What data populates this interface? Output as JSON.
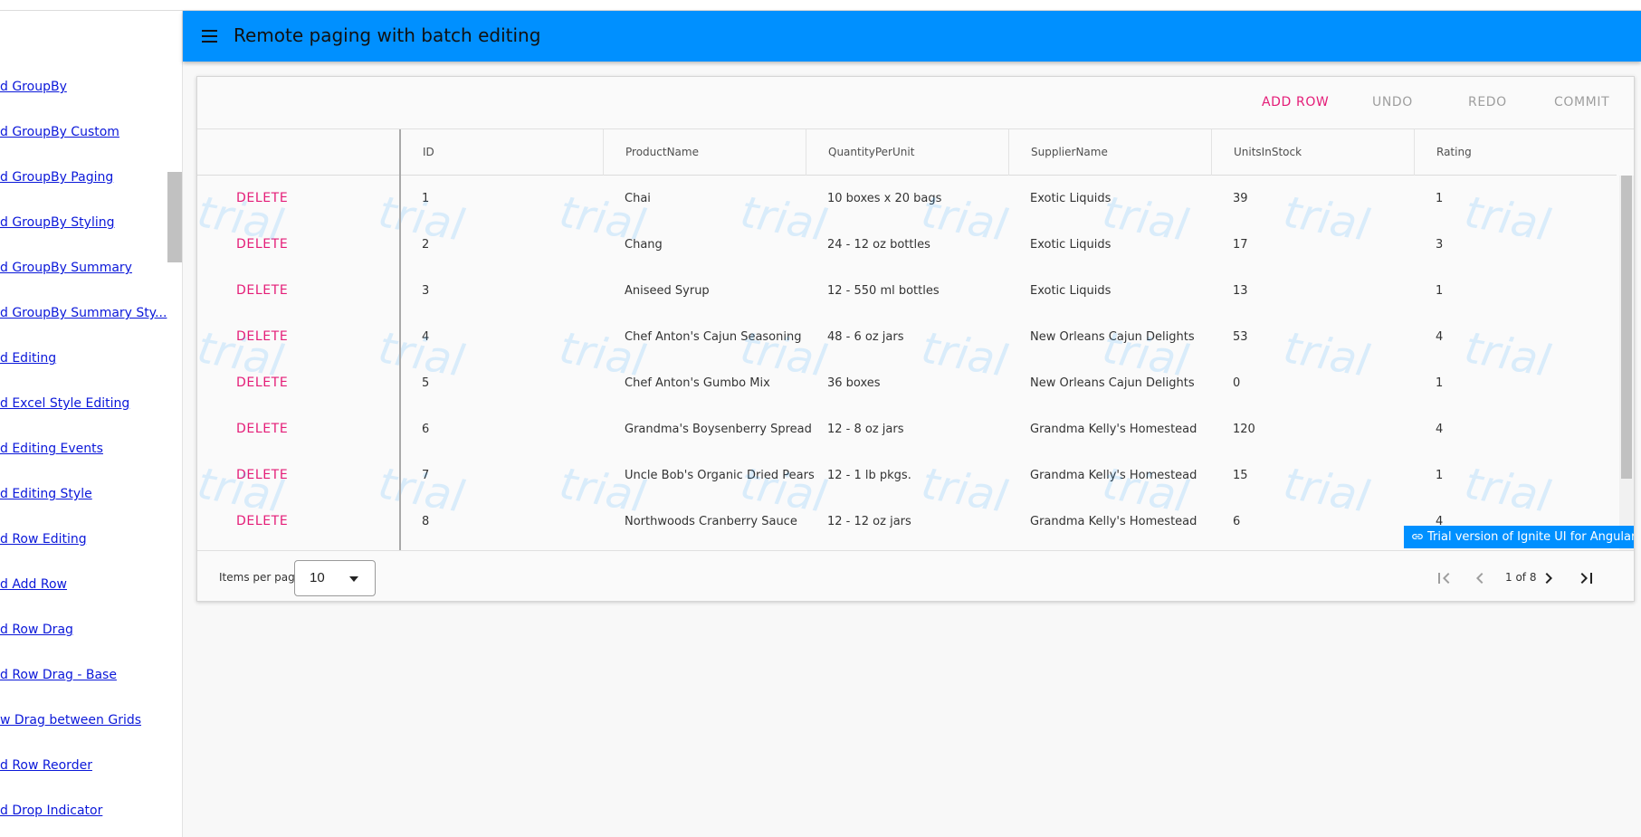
{
  "header": {
    "title": "Remote paging with batch editing"
  },
  "sidebar": {
    "items": [
      "d GroupBy",
      "d GroupBy Custom",
      "d GroupBy Paging",
      "d GroupBy Styling",
      "d GroupBy Summary",
      "d GroupBy Summary Sty...",
      "d Editing",
      "d Excel Style Editing",
      "d Editing Events",
      "d Editing Style",
      "d Row Editing",
      "d Add Row",
      "d Row Drag",
      "d Row Drag - Base",
      "w Drag between Grids",
      "d Row Reorder",
      "d Drop Indicator"
    ]
  },
  "toolbar": {
    "add_row": "ADD ROW",
    "undo": "UNDO",
    "redo": "REDO",
    "commit": "COMMIT"
  },
  "grid": {
    "columns": [
      "ID",
      "ProductName",
      "QuantityPerUnit",
      "SupplierName",
      "UnitsInStock",
      "Rating"
    ],
    "delete_label": "DELETE",
    "rows": [
      [
        "1",
        "Chai",
        "10 boxes x 20 bags",
        "Exotic Liquids",
        "39",
        "1"
      ],
      [
        "2",
        "Chang",
        "24 - 12 oz bottles",
        "Exotic Liquids",
        "17",
        "3"
      ],
      [
        "3",
        "Aniseed Syrup",
        "12 - 550 ml bottles",
        "Exotic Liquids",
        "13",
        "1"
      ],
      [
        "4",
        "Chef Anton's Cajun Seasoning",
        "48 - 6 oz jars",
        "New Orleans Cajun Delights",
        "53",
        "4"
      ],
      [
        "5",
        "Chef Anton's Gumbo Mix",
        "36 boxes",
        "New Orleans Cajun Delights",
        "0",
        "1"
      ],
      [
        "6",
        "Grandma's Boysenberry Spread",
        "12 - 8 oz jars",
        "Grandma Kelly's Homestead",
        "120",
        "4"
      ],
      [
        "7",
        "Uncle Bob's Organic Dried Pears",
        "12 - 1 lb pkgs.",
        "Grandma Kelly's Homestead",
        "15",
        "1"
      ],
      [
        "8",
        "Northwoods Cranberry Sauce",
        "12 - 12 oz jars",
        "Grandma Kelly's Homestead",
        "6",
        "4"
      ]
    ],
    "watermark_text": "trial",
    "trial_badge": "Trial version of Ignite UI for Angular"
  },
  "paginator": {
    "items_per_page_label": "Items per page",
    "items_per_page_value": "10",
    "page_text": "1 of 8"
  },
  "colors": {
    "appbar": "#0090ff",
    "accent": "#e41c77",
    "disabled": "#9e9e9e",
    "link": "#0b18d9"
  }
}
